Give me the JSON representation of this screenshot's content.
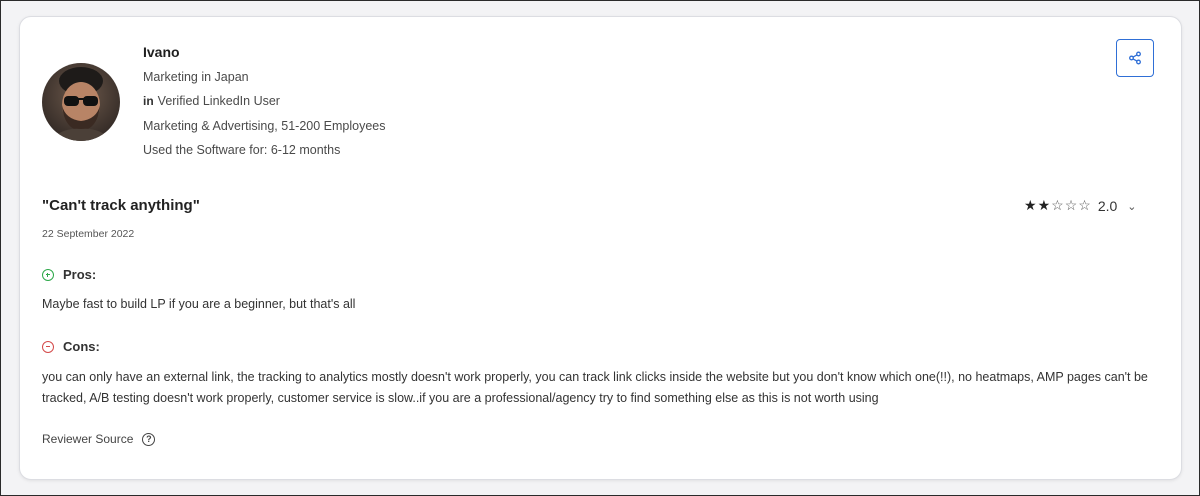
{
  "reviewer": {
    "name": "Ivano",
    "role": "Marketing in Japan",
    "linkedin_icon": "in",
    "verified": "Verified LinkedIn User",
    "industry": "Marketing & Advertising, 51-200 Employees",
    "usage": "Used the Software for: 6-12 months"
  },
  "review": {
    "title": "\"Can't track anything\"",
    "date": "22 September 2022",
    "rating_value": "2.0",
    "rating_stars": 2,
    "rating_max": 5,
    "pros_label": "Pros:",
    "pros_text": "Maybe fast to build LP if you are a beginner, but that's all",
    "cons_label": "Cons:",
    "cons_text": "you can only have an external link, the tracking to analytics mostly doesn't work properly, you can track link clicks inside the website but you don't know which one(!!), no heatmaps, AMP pages can't be tracked, A/B testing doesn't work properly, customer service is slow..if you are a professional/agency try to find something else as this is not worth using",
    "reviewer_source_label": "Reviewer Source",
    "help_glyph": "?"
  },
  "icons": {
    "share": "share-icon",
    "chevron": "chevron-down-icon",
    "pros": "plus-circle-icon",
    "cons": "minus-circle-icon",
    "help": "question-circle-icon",
    "star_full": "★",
    "star_empty": "☆",
    "chevron_glyph": "⌄"
  },
  "colors": {
    "share_border": "#2f6fd6",
    "pros_accent": "#2ea84a",
    "cons_accent": "#d44a4a"
  }
}
